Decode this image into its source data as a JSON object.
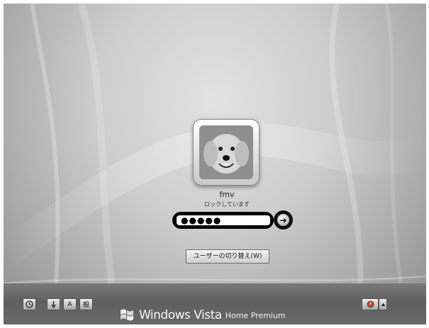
{
  "user": {
    "name": "fmv",
    "status": "ロックしています"
  },
  "password": {
    "masked_value": "●●●●●"
  },
  "switch_user_label": "ユーザーの切り替え(W)",
  "toolbar": {
    "ime_a_label": "A",
    "ime_mode_label": "般"
  },
  "branding": {
    "product": "Windows Vista",
    "edition": "Home Premium"
  },
  "icons": {
    "submit": "arrow-right-icon",
    "ease_of_access": "ease-of-access-icon",
    "power": "power-icon",
    "options": "chevron-up-icon"
  }
}
